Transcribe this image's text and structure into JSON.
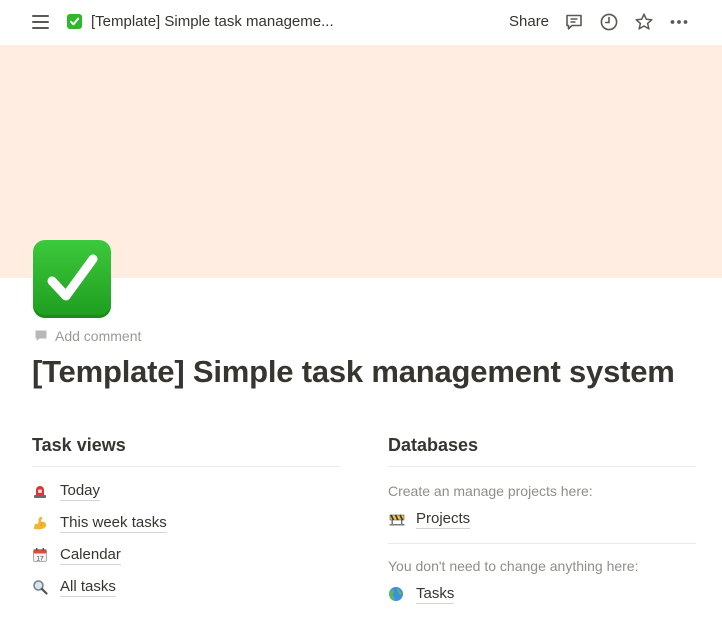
{
  "topbar": {
    "page_title": "[Template] Simple task manageme...",
    "share_label": "Share",
    "icons": [
      "menu-icon",
      "check-icon",
      "comment-icon",
      "clock-icon",
      "star-icon",
      "more-icon"
    ]
  },
  "page": {
    "cover_color": "#feede0",
    "icon": "white-check-mark-icon",
    "add_comment_label": "Add comment",
    "title": "[Template] Simple task management system"
  },
  "task_views": {
    "heading": "Task views",
    "items": [
      {
        "icon": "siren-icon",
        "label": "Today"
      },
      {
        "icon": "flexed-biceps-icon",
        "label": "This week tasks"
      },
      {
        "icon": "calendar-icon",
        "label": "Calendar"
      },
      {
        "icon": "magnifying-glass-icon",
        "label": "All tasks"
      }
    ]
  },
  "databases": {
    "heading": "Databases",
    "projects_note": "Create an manage projects here:",
    "projects_link": {
      "icon": "construction-icon",
      "label": "Projects"
    },
    "tasks_note": "You don't need to change anything here:",
    "tasks_link": {
      "icon": "globe-icon",
      "label": "Tasks"
    }
  }
}
